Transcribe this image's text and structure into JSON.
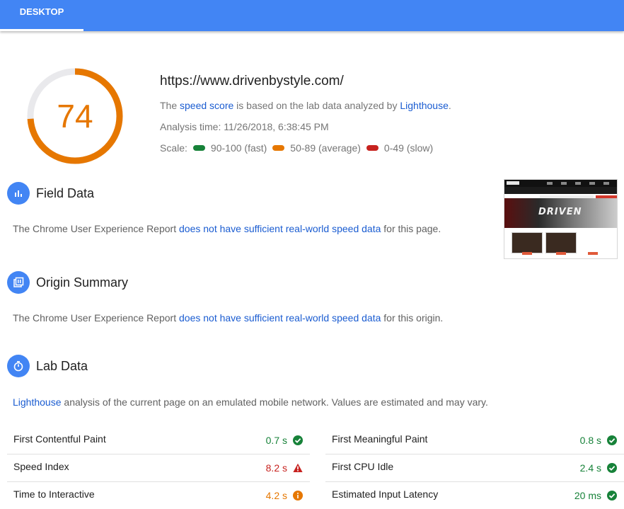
{
  "tabs": [
    {
      "label": "DESKTOP",
      "active": true
    }
  ],
  "score": {
    "value": "74",
    "fraction": 0.74,
    "color": "#e67700"
  },
  "summary": {
    "url": "https://www.drivenbystyle.com/",
    "speed_prefix": "The ",
    "speed_link": "speed score",
    "speed_middle": " is based on the lab data analyzed by ",
    "speed_link2": "Lighthouse",
    "speed_suffix": ".",
    "analysis_time": "Analysis time: 11/26/2018, 6:38:45 PM",
    "scale_label": "Scale:",
    "scale_fast": "90-100 (fast)",
    "scale_average": "50-89 (average)",
    "scale_slow": "0-49 (slow)"
  },
  "field_data": {
    "title": "Field Data",
    "text_prefix": "The Chrome User Experience Report ",
    "text_link": "does not have sufficient real-world speed data",
    "text_suffix": " for this page."
  },
  "origin_summary": {
    "title": "Origin Summary",
    "text_prefix": "The Chrome User Experience Report ",
    "text_link": "does not have sufficient real-world speed data",
    "text_suffix": " for this origin."
  },
  "lab_data": {
    "title": "Lab Data",
    "intro_link": "Lighthouse",
    "intro_suffix": " analysis of the current page on an emulated mobile network. Values are estimated and may vary.",
    "metrics_left": [
      {
        "name": "First Contentful Paint",
        "value": "0.7 s",
        "status": "pass"
      },
      {
        "name": "Speed Index",
        "value": "8.2 s",
        "status": "fail"
      },
      {
        "name": "Time to Interactive",
        "value": "4.2 s",
        "status": "average"
      }
    ],
    "metrics_right": [
      {
        "name": "First Meaningful Paint",
        "value": "0.8 s",
        "status": "pass"
      },
      {
        "name": "First CPU Idle",
        "value": "2.4 s",
        "status": "pass"
      },
      {
        "name": "Estimated Input Latency",
        "value": "20 ms",
        "status": "pass"
      }
    ]
  },
  "thumbnail": {
    "hero_text": "DRIVEN",
    "logo_text": "DRIVEN"
  },
  "colors": {
    "accent": "#4285f4",
    "pass": "#178239",
    "average": "#e67700",
    "fail": "#c7221f",
    "link": "#1a5cd1"
  }
}
